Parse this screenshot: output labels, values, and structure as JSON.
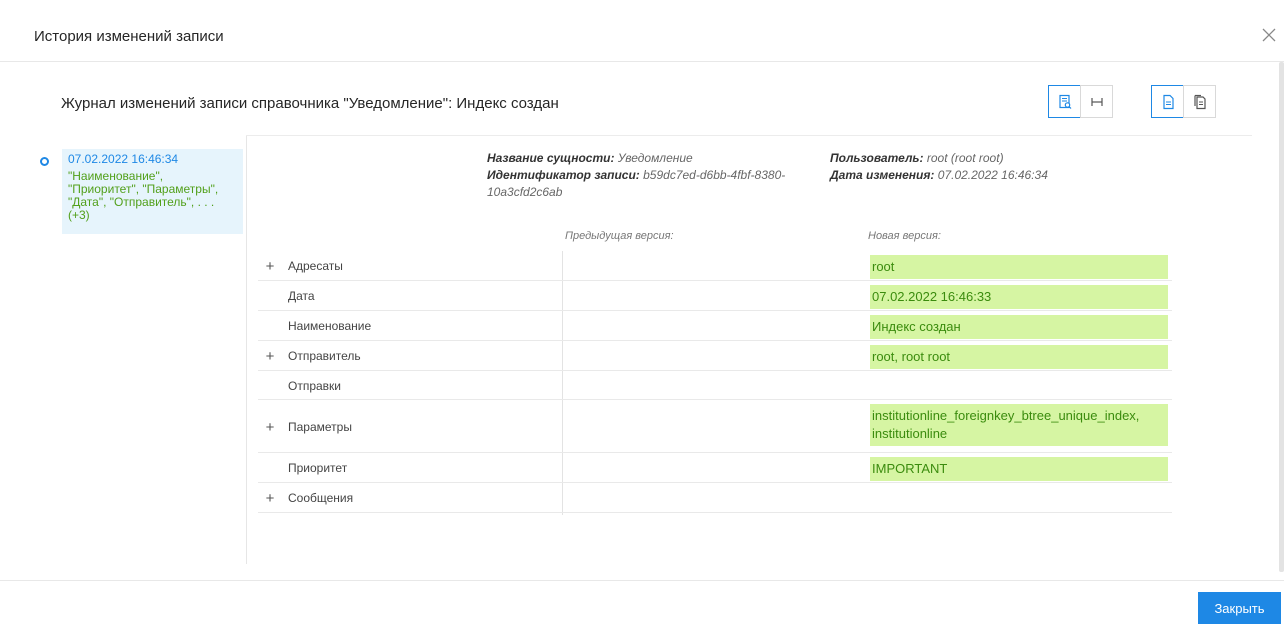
{
  "dialog": {
    "title": "История изменений записи",
    "close_icon": "close-icon"
  },
  "journal": {
    "title": "Журнал изменений записи справочника \"Уведомление\": Индекс создан"
  },
  "toolbar": {
    "group1": [
      {
        "icon": "document-search-icon",
        "active": true
      },
      {
        "icon": "column-width-icon",
        "active": false
      }
    ],
    "group2": [
      {
        "icon": "document-text-icon",
        "active": true
      },
      {
        "icon": "documents-compare-icon",
        "active": false
      }
    ]
  },
  "timeline": {
    "date": "07.02.2022 16:46:34",
    "fields": "\"Наименование\", \"Приоритет\", \"Параметры\", \"Дата\", \"Отправитель\", . . . (+3)"
  },
  "meta": {
    "entity_label": "Название сущности:",
    "entity_value": " Уведомление",
    "record_id_label": "Идентификатор записи:",
    "record_id_value": " b59dc7ed-d6bb-4fbf-8380-10a3cfd2c6ab",
    "user_label": "Пользователь:",
    "user_value": " root (root root)",
    "changed_label": "Дата изменения:",
    "changed_value": " 07.02.2022 16:46:34"
  },
  "columns": {
    "prev": "Предыдущая версия:",
    "new": "Новая версия:"
  },
  "rows": [
    {
      "label": "Адресаты",
      "expandable": true,
      "new": "root"
    },
    {
      "label": "Дата",
      "expandable": false,
      "new": "07.02.2022 16:46:33"
    },
    {
      "label": "Наименование",
      "expandable": false,
      "new": "Индекс создан"
    },
    {
      "label": "Отправитель",
      "expandable": true,
      "new": "root, root root"
    },
    {
      "label": "Отправки",
      "expandable": false,
      "new": ""
    },
    {
      "label": "Параметры",
      "expandable": true,
      "new": "institutionline_foreignkey_btree_unique_index, institutionline"
    },
    {
      "label": "Приоритет",
      "expandable": false,
      "new": "IMPORTANT"
    },
    {
      "label": "Сообщения",
      "expandable": true,
      "new": ""
    }
  ],
  "footer": {
    "close_label": "Закрыть"
  },
  "colors": {
    "accent": "#1e88e5",
    "new_value_bg": "#d6f5a3",
    "new_value_text": "#3b8c0e",
    "timeline_bg": "#e6f4fc"
  }
}
